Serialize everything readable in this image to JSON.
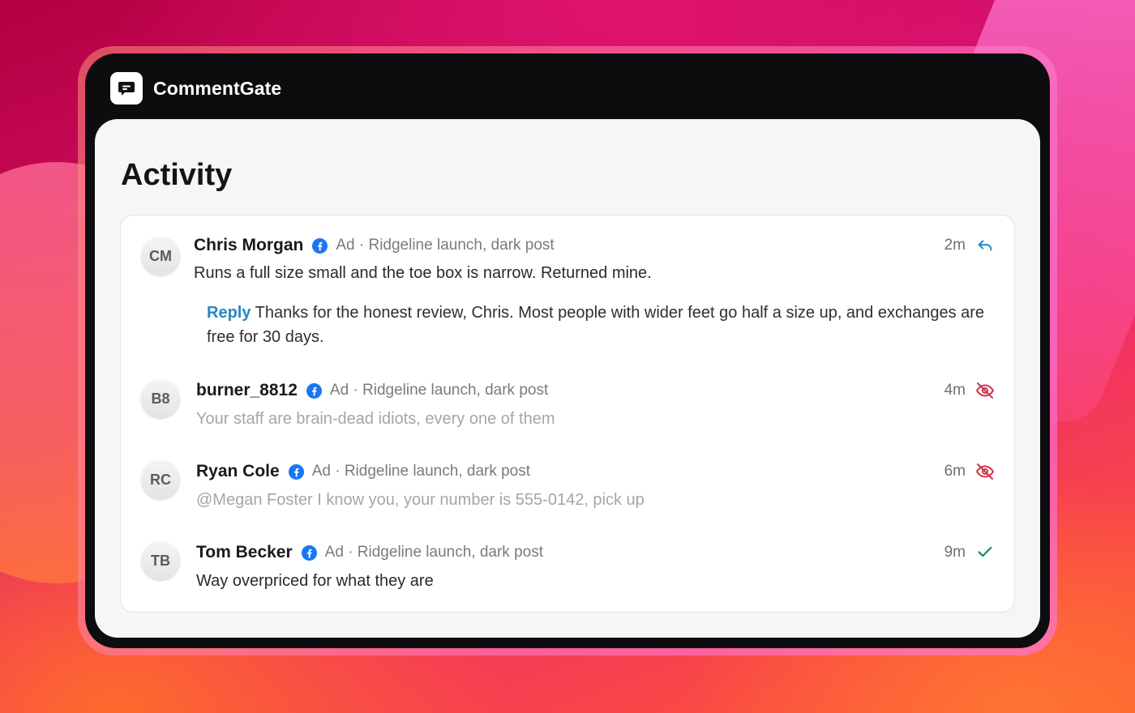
{
  "app": {
    "title": "CommentGate",
    "logo_icon": "chat-bubble-icon"
  },
  "page": {
    "title": "Activity"
  },
  "colors": {
    "reply_accent": "#2a86c6",
    "hidden_status": "#d0344a",
    "approved_status": "#1f8a5a",
    "facebook": "#1877f2"
  },
  "comments": [
    {
      "initials": "CM",
      "author": "Chris Morgan",
      "platform_icon": "facebook-icon",
      "meta": "Ad · Ridgeline launch, dark post",
      "time": "2m",
      "text": "Runs a full size small and the toe box is narrow. Returned mine.",
      "status": "replied",
      "status_icon": "reply-icon",
      "reply_label": "Reply",
      "reply_text": "Thanks for the honest review, Chris. Most people with wider feet go half a size up, and exchanges are free for 30 days."
    },
    {
      "initials": "B8",
      "author": "burner_8812",
      "platform_icon": "facebook-icon",
      "meta": "Ad · Ridgeline launch, dark post",
      "time": "4m",
      "text": "Your staff are brain-dead idiots, every one of them",
      "status": "hidden",
      "status_icon": "eye-off-icon"
    },
    {
      "initials": "RC",
      "author": "Ryan Cole",
      "platform_icon": "facebook-icon",
      "meta": "Ad · Ridgeline launch, dark post",
      "time": "6m",
      "text": "@Megan Foster I know you, your number is 555-0142, pick up",
      "status": "hidden",
      "status_icon": "eye-off-icon"
    },
    {
      "initials": "TB",
      "author": "Tom Becker",
      "platform_icon": "facebook-icon",
      "meta": "Ad · Ridgeline launch, dark post",
      "time": "9m",
      "text": "Way overpriced for what they are",
      "status": "approved",
      "status_icon": "checkmark-icon"
    }
  ]
}
